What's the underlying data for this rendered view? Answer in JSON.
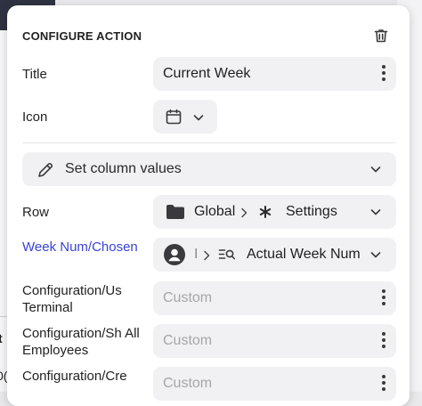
{
  "background": {
    "fragment_a": "t",
    "fragment_b": "0("
  },
  "panel": {
    "header": "CONFIGURE ACTION",
    "title_label": "Title",
    "title_value": "Current Week",
    "icon_label": "Icon",
    "section_label": "Set column values",
    "row_label": "Row",
    "row_path": [
      "Global",
      "Settings"
    ],
    "week_label": "Week Num/Chosen",
    "week_value_prefix": "I",
    "week_value": "Actual Week Num",
    "config_rows": [
      {
        "label": "Configuration/Us Terminal",
        "placeholder": "Custom"
      },
      {
        "label": "Configuration/Sh All Employees",
        "placeholder": "Custom"
      },
      {
        "label": "Configuration/Cre",
        "placeholder": "Custom"
      }
    ]
  },
  "icons": {
    "header_action": "trash-icon",
    "icon_picker": "calendar-icon",
    "section": "pencil-icon",
    "row_root": "folder-icon",
    "row_settings": "asterisk-icon",
    "week_source": "user-avatar-icon",
    "week_lookup": "lookup-list-icon"
  },
  "colors": {
    "link_label": "#3a43d6",
    "field_bg": "#f1f1f3",
    "placeholder": "#a5a5ab"
  }
}
